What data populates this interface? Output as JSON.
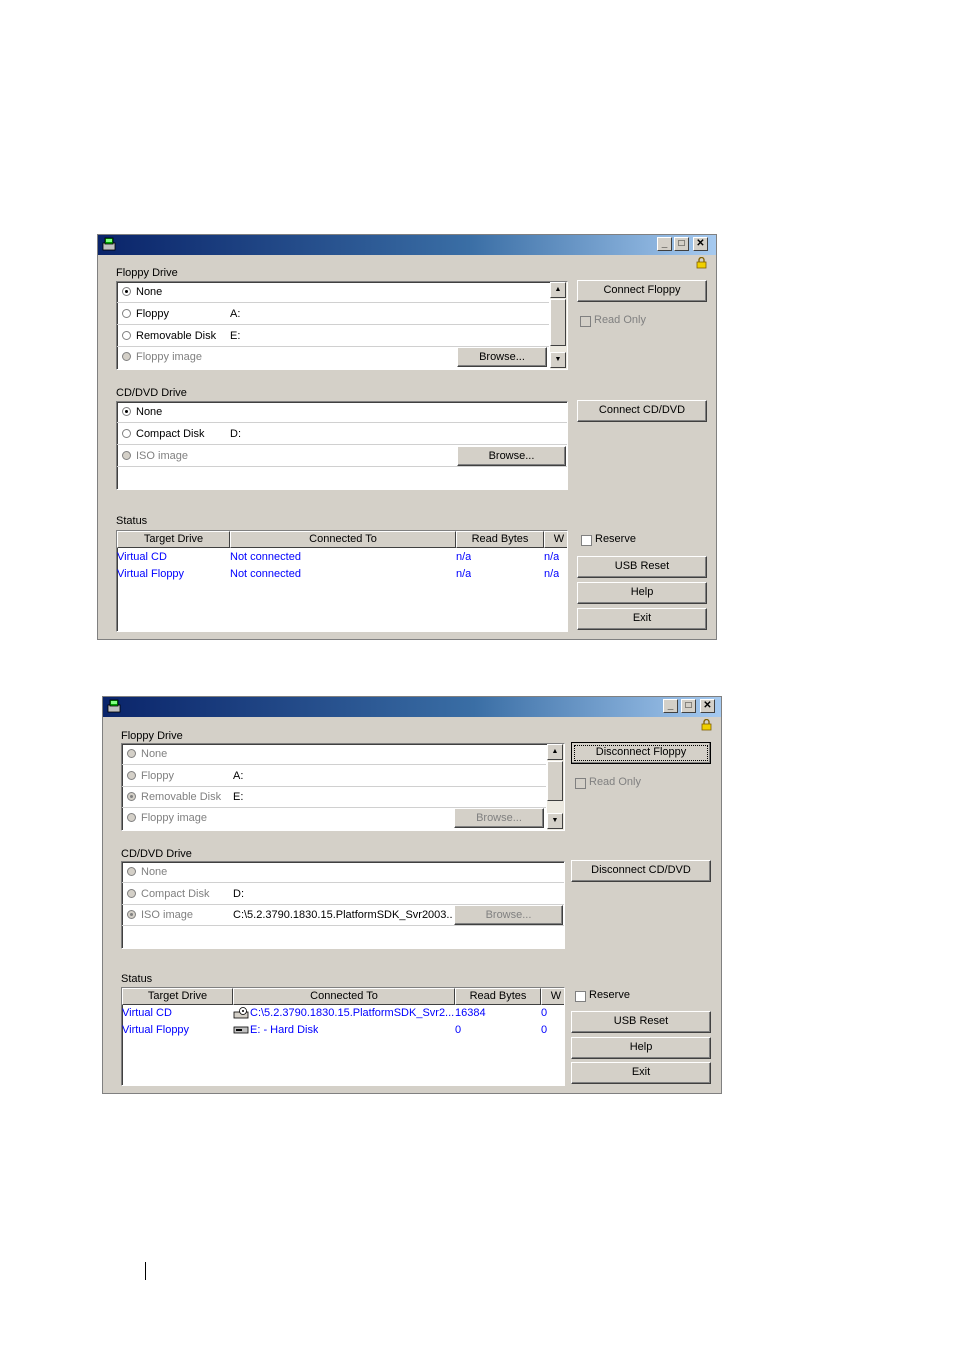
{
  "windows": [
    {
      "floppy": {
        "label": "Floppy Drive",
        "options": [
          {
            "label": "None",
            "value": "",
            "selected": true,
            "disabled": false
          },
          {
            "label": "Floppy",
            "value": "A:",
            "selected": false,
            "disabled": false
          },
          {
            "label": "Removable Disk",
            "value": "E:",
            "selected": false,
            "disabled": false
          },
          {
            "label": "Floppy image",
            "value": "",
            "selected": false,
            "disabled": true
          }
        ],
        "browse": "Browse...",
        "connect": "Connect Floppy",
        "read_only": "Read Only"
      },
      "cd": {
        "label": "CD/DVD Drive",
        "options": [
          {
            "label": "None",
            "value": "",
            "selected": true,
            "disabled": false
          },
          {
            "label": "Compact Disk",
            "value": "D:",
            "selected": false,
            "disabled": false
          },
          {
            "label": "ISO image",
            "value": "",
            "selected": false,
            "disabled": true
          }
        ],
        "browse": "Browse...",
        "connect": "Connect CD/DVD"
      },
      "status": {
        "label": "Status",
        "columns": [
          "Target Drive",
          "Connected To",
          "Read Bytes",
          "W"
        ],
        "rows": [
          {
            "target": "Virtual CD",
            "connected": "Not connected",
            "read": "n/a",
            "w": "n/a",
            "icon": ""
          },
          {
            "target": "Virtual Floppy",
            "connected": "Not connected",
            "read": "n/a",
            "w": "n/a",
            "icon": ""
          }
        ]
      },
      "reserve": "Reserve",
      "usb_reset": "USB Reset",
      "help": "Help",
      "exit": "Exit"
    },
    {
      "floppy": {
        "label": "Floppy Drive",
        "options": [
          {
            "label": "None",
            "value": "",
            "selected": false,
            "disabled": true
          },
          {
            "label": "Floppy",
            "value": "A:",
            "selected": false,
            "disabled": true
          },
          {
            "label": "Removable Disk",
            "value": "E:",
            "selected": true,
            "disabled": true
          },
          {
            "label": "Floppy image",
            "value": "",
            "selected": false,
            "disabled": true
          }
        ],
        "browse": "Browse...",
        "connect": "Disconnect Floppy",
        "read_only": "Read Only"
      },
      "cd": {
        "label": "CD/DVD Drive",
        "options": [
          {
            "label": "None",
            "value": "",
            "selected": false,
            "disabled": true
          },
          {
            "label": "Compact Disk",
            "value": "D:",
            "selected": false,
            "disabled": true
          },
          {
            "label": "ISO image",
            "value": "C:\\5.2.3790.1830.15.PlatformSDK_Svr2003...",
            "selected": true,
            "disabled": true
          }
        ],
        "browse": "Browse...",
        "connect": "Disconnect CD/DVD"
      },
      "status": {
        "label": "Status",
        "columns": [
          "Target Drive",
          "Connected To",
          "Read Bytes",
          "W"
        ],
        "rows": [
          {
            "target": "Virtual CD",
            "connected": "C:\\5.2.3790.1830.15.PlatformSDK_Svr2...",
            "read": "16384",
            "w": "0",
            "icon": "cd-drive-icon"
          },
          {
            "target": "Virtual Floppy",
            "connected": "E: - Hard Disk",
            "read": "0",
            "w": "0",
            "icon": "hard-disk-icon"
          }
        ]
      },
      "reserve": "Reserve",
      "usb_reset": "USB Reset",
      "help": "Help",
      "exit": "Exit"
    }
  ]
}
